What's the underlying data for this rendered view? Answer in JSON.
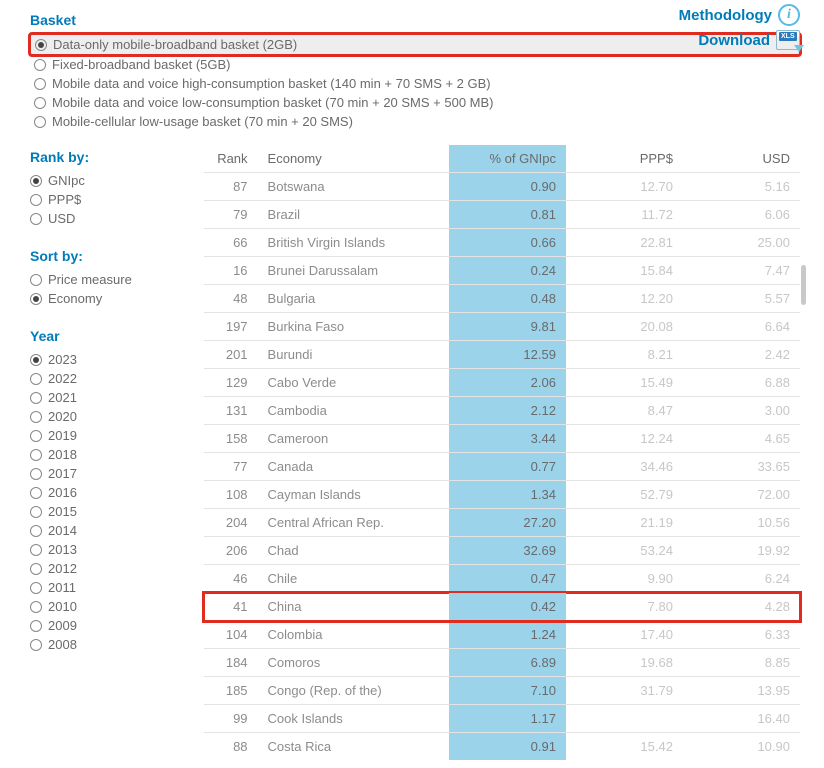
{
  "basket": {
    "title": "Basket",
    "options": [
      "Data-only mobile-broadband basket (2GB)",
      "Fixed-broadband basket (5GB)",
      "Mobile data and voice high-consumption basket (140 min + 70 SMS + 2 GB)",
      "Mobile data and voice low-consumption basket (70 min + 20 SMS + 500 MB)",
      "Mobile-cellular low-usage basket (70 min + 20 SMS)"
    ],
    "selected_index": 0
  },
  "links": {
    "methodology": "Methodology",
    "download": "Download"
  },
  "rank_by": {
    "title": "Rank by:",
    "options": [
      "GNIpc",
      "PPP$",
      "USD"
    ],
    "selected_index": 0
  },
  "sort_by": {
    "title": "Sort by:",
    "options": [
      "Price measure",
      "Economy"
    ],
    "selected_index": 1
  },
  "year": {
    "title": "Year",
    "options": [
      "2023",
      "2022",
      "2021",
      "2020",
      "2019",
      "2018",
      "2017",
      "2016",
      "2015",
      "2014",
      "2013",
      "2012",
      "2011",
      "2010",
      "2009",
      "2008"
    ],
    "selected_index": 0
  },
  "table": {
    "headers": {
      "rank": "Rank",
      "economy": "Economy",
      "gni": "% of GNIpc",
      "ppp": "PPP$",
      "usd": "USD"
    },
    "rows": [
      {
        "rank": "87",
        "economy": "Botswana",
        "gni": "0.90",
        "ppp": "12.70",
        "usd": "5.16"
      },
      {
        "rank": "79",
        "economy": "Brazil",
        "gni": "0.81",
        "ppp": "11.72",
        "usd": "6.06"
      },
      {
        "rank": "66",
        "economy": "British Virgin Islands",
        "gni": "0.66",
        "ppp": "22.81",
        "usd": "25.00"
      },
      {
        "rank": "16",
        "economy": "Brunei Darussalam",
        "gni": "0.24",
        "ppp": "15.84",
        "usd": "7.47"
      },
      {
        "rank": "48",
        "economy": "Bulgaria",
        "gni": "0.48",
        "ppp": "12.20",
        "usd": "5.57"
      },
      {
        "rank": "197",
        "economy": "Burkina Faso",
        "gni": "9.81",
        "ppp": "20.08",
        "usd": "6.64"
      },
      {
        "rank": "201",
        "economy": "Burundi",
        "gni": "12.59",
        "ppp": "8.21",
        "usd": "2.42"
      },
      {
        "rank": "129",
        "economy": "Cabo Verde",
        "gni": "2.06",
        "ppp": "15.49",
        "usd": "6.88"
      },
      {
        "rank": "131",
        "economy": "Cambodia",
        "gni": "2.12",
        "ppp": "8.47",
        "usd": "3.00"
      },
      {
        "rank": "158",
        "economy": "Cameroon",
        "gni": "3.44",
        "ppp": "12.24",
        "usd": "4.65"
      },
      {
        "rank": "77",
        "economy": "Canada",
        "gni": "0.77",
        "ppp": "34.46",
        "usd": "33.65"
      },
      {
        "rank": "108",
        "economy": "Cayman Islands",
        "gni": "1.34",
        "ppp": "52.79",
        "usd": "72.00"
      },
      {
        "rank": "204",
        "economy": "Central African Rep.",
        "gni": "27.20",
        "ppp": "21.19",
        "usd": "10.56"
      },
      {
        "rank": "206",
        "economy": "Chad",
        "gni": "32.69",
        "ppp": "53.24",
        "usd": "19.92"
      },
      {
        "rank": "46",
        "economy": "Chile",
        "gni": "0.47",
        "ppp": "9.90",
        "usd": "6.24"
      },
      {
        "rank": "41",
        "economy": "China",
        "gni": "0.42",
        "ppp": "7.80",
        "usd": "4.28",
        "highlight": true
      },
      {
        "rank": "104",
        "economy": "Colombia",
        "gni": "1.24",
        "ppp": "17.40",
        "usd": "6.33"
      },
      {
        "rank": "184",
        "economy": "Comoros",
        "gni": "6.89",
        "ppp": "19.68",
        "usd": "8.85"
      },
      {
        "rank": "185",
        "economy": "Congo (Rep. of the)",
        "gni": "7.10",
        "ppp": "31.79",
        "usd": "13.95"
      },
      {
        "rank": "99",
        "economy": "Cook Islands",
        "gni": "1.17",
        "ppp": "",
        "usd": "16.40"
      },
      {
        "rank": "88",
        "economy": "Costa Rica",
        "gni": "0.91",
        "ppp": "15.42",
        "usd": "10.90"
      }
    ]
  }
}
